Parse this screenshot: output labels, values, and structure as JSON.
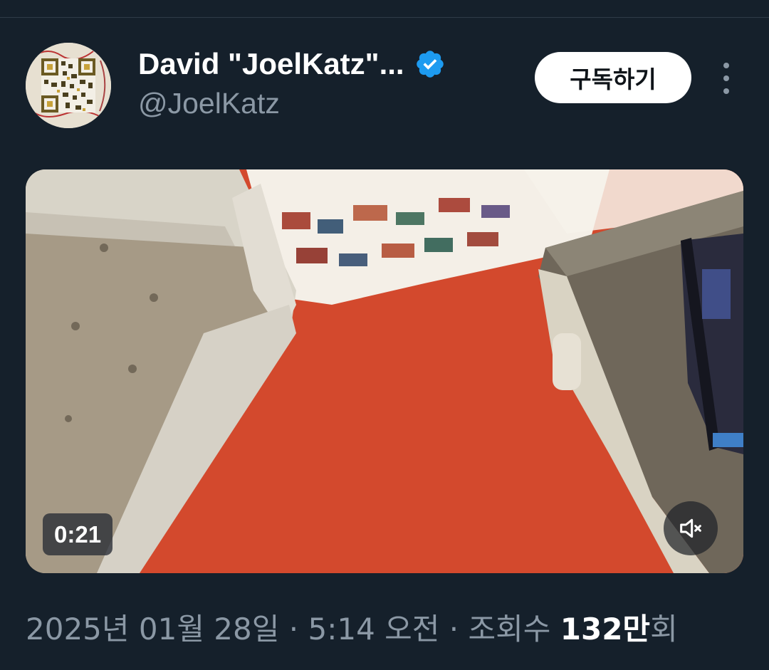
{
  "tweet": {
    "author": {
      "display_name": "David \"JoelKatz\"...",
      "handle": "@JoelKatz",
      "verified": true,
      "avatar_icon": "qr-code-avatar"
    },
    "subscribe_label": "구독하기",
    "more_icon": "more-vertical-icon",
    "media": {
      "type": "video",
      "duration": "0:21",
      "muted": true,
      "mute_icon": "speaker-muted-icon"
    },
    "meta": {
      "date": "2025년 01월 28일",
      "separator1": " · ",
      "time": "5:14 오전",
      "separator2": " · ",
      "views_label": "조회수 ",
      "views_value": "132만",
      "views_suffix": "회"
    }
  },
  "colors": {
    "background": "#15202b",
    "verified": "#1d9bf0",
    "muted_text": "#8b98a5"
  }
}
